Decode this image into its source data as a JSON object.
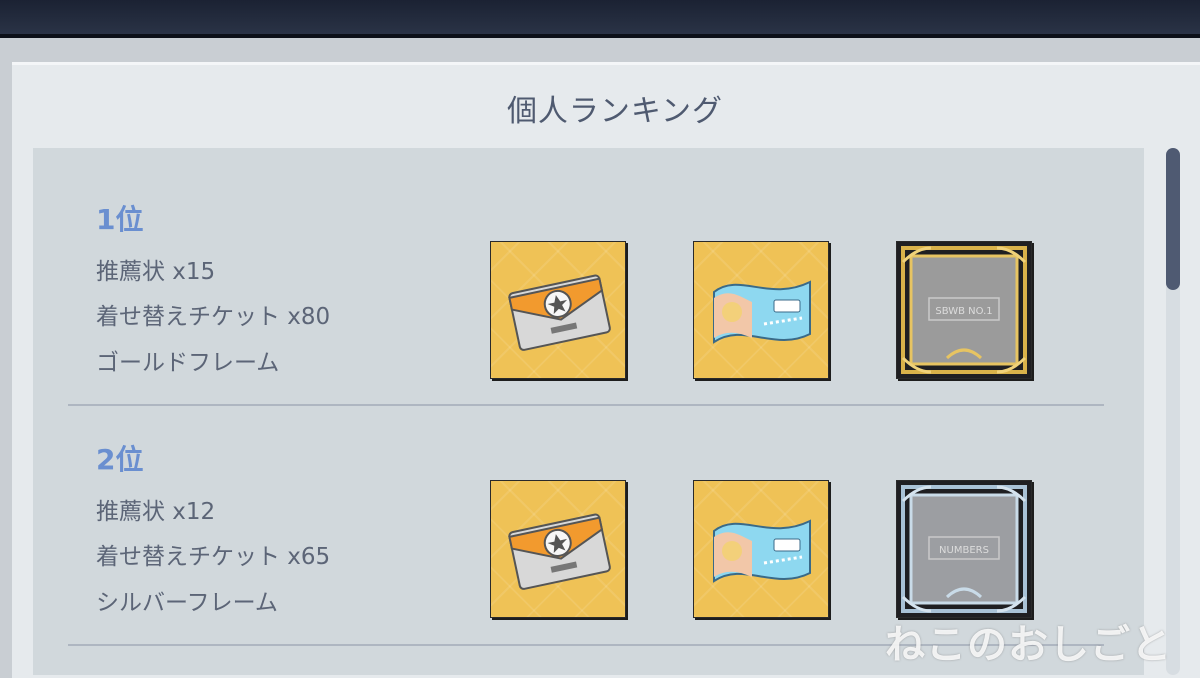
{
  "panel": {
    "title": "個人ランキング"
  },
  "rankings": [
    {
      "rank": "1位",
      "rewards": [
        "推薦状 x15",
        "着せ替えチケット x80",
        "ゴールドフレーム"
      ],
      "items": [
        {
          "icon": "recommendation-letter-icon"
        },
        {
          "icon": "costume-ticket-icon"
        },
        {
          "icon": "gold-frame-icon",
          "frame_text": "SBWB NO.1"
        }
      ]
    },
    {
      "rank": "2位",
      "rewards": [
        "推薦状 x12",
        "着せ替えチケット x65",
        "シルバーフレーム"
      ],
      "items": [
        {
          "icon": "recommendation-letter-icon"
        },
        {
          "icon": "costume-ticket-icon"
        },
        {
          "icon": "silver-frame-icon",
          "frame_text": "NUMBERS"
        }
      ]
    }
  ],
  "watermark": "ねこのおしごと",
  "colors": {
    "rank": "#6a8fd0",
    "tile": "#efc256",
    "gold": "#d9b24a",
    "silver": "#a9c2d6"
  }
}
